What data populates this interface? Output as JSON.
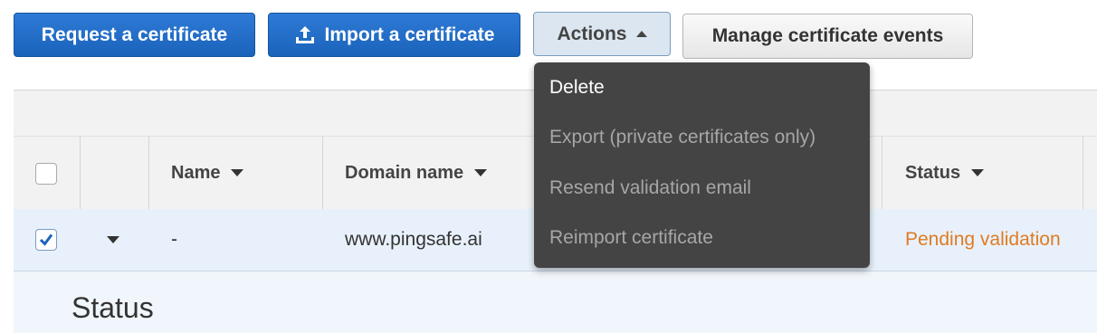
{
  "toolbar": {
    "request_label": "Request a certificate",
    "import_label": "Import a certificate",
    "actions_label": "Actions",
    "manage_events_label": "Manage certificate events"
  },
  "actions_menu": {
    "items": [
      {
        "label": "Delete",
        "enabled": true
      },
      {
        "label": "Export (private certificates only)",
        "enabled": false
      },
      {
        "label": "Resend validation email",
        "enabled": false
      },
      {
        "label": "Reimport certificate",
        "enabled": false
      }
    ]
  },
  "table": {
    "columns": [
      "Name",
      "Domain name",
      "Status"
    ],
    "row": {
      "name": "-",
      "domain": "www.pingsafe.ai",
      "status": "Pending validation",
      "selected": true
    }
  },
  "detail": {
    "title": "Status"
  },
  "colors": {
    "primary": "#1a63bb",
    "pending": "#e07b22",
    "menu_bg": "#444444",
    "selected_row": "#e8f1fb"
  }
}
